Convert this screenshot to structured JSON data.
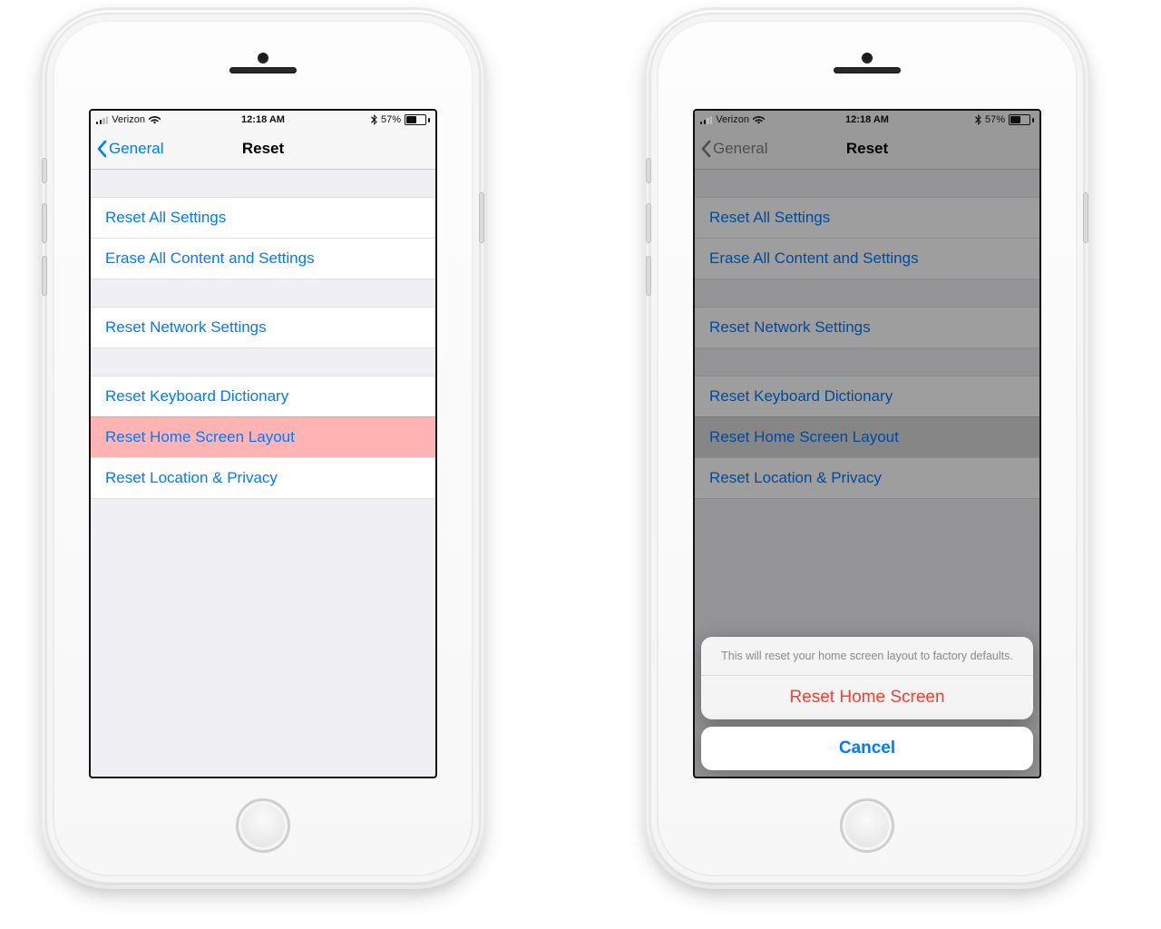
{
  "status": {
    "carrier": "Verizon",
    "time": "12:18 AM",
    "battery_pct_label": "57%",
    "battery_fill_pct": 57
  },
  "nav": {
    "back_label": "General",
    "title": "Reset"
  },
  "rows": {
    "reset_all": "Reset All Settings",
    "erase_all": "Erase All Content and Settings",
    "reset_network": "Reset Network Settings",
    "reset_keyboard": "Reset Keyboard Dictionary",
    "reset_home_layout": "Reset Home Screen Layout",
    "reset_location": "Reset Location & Privacy"
  },
  "sheet": {
    "message": "This will reset your home screen layout to factory defaults.",
    "destructive": "Reset Home Screen",
    "cancel": "Cancel"
  },
  "colors": {
    "ios_blue": "#007aff",
    "ios_red": "#ff3b30",
    "highlight_row": "#ffb3b3",
    "table_bg": "#efeff4"
  }
}
